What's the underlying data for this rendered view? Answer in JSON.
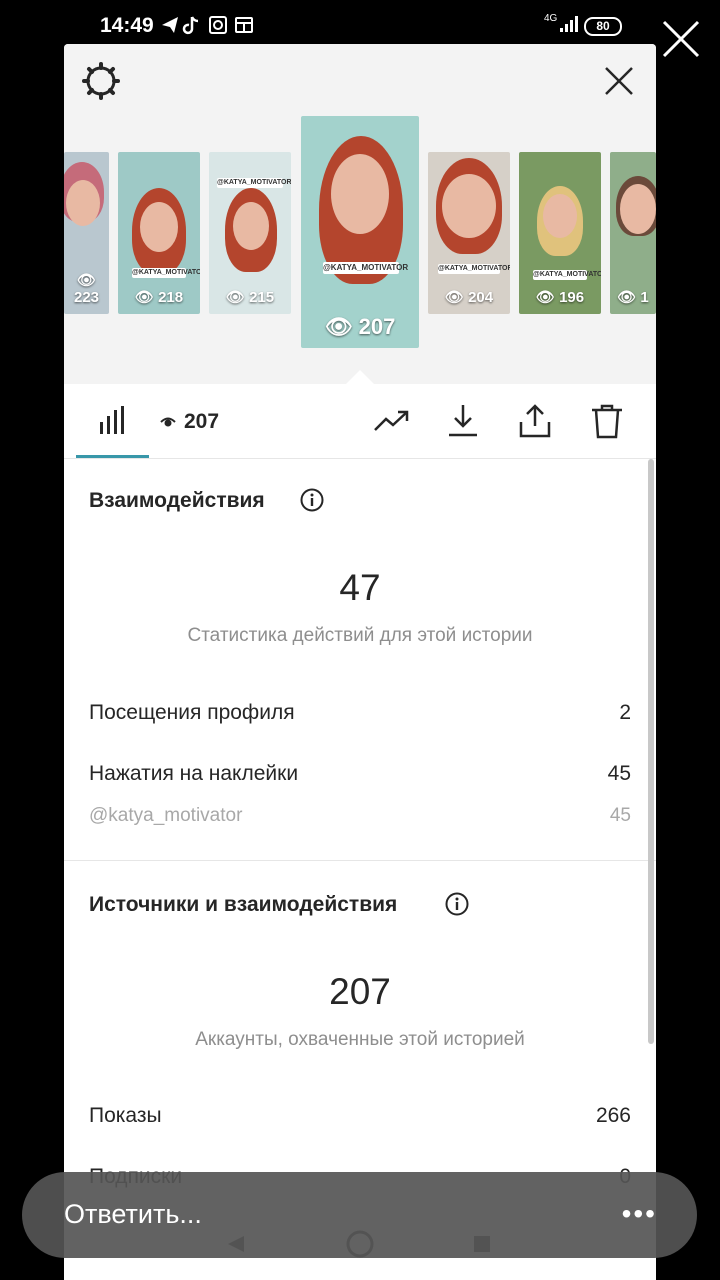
{
  "status_bar": {
    "time": "14:49",
    "network": "4G",
    "battery": "80"
  },
  "thumbnails": [
    {
      "views": "223",
      "tag": ""
    },
    {
      "views": "218",
      "tag": "@KATYA_MOTIVATOR"
    },
    {
      "views": "215",
      "tag": "@KATYA_MOTIVATOR"
    },
    {
      "views": "207",
      "tag": "@KATYA_MOTIVATOR"
    },
    {
      "views": "204",
      "tag": "@KATYA_MOTIVATOR"
    },
    {
      "views": "196",
      "tag": "@KATYA_MOTIVATOR"
    },
    {
      "views": "1",
      "tag": ""
    }
  ],
  "toolbar": {
    "views_count": "207"
  },
  "interactions": {
    "title": "Взаимодействия",
    "total": "47",
    "subtitle": "Статистика действий для этой истории",
    "rows": [
      {
        "label": "Посещения профиля",
        "value": "2"
      },
      {
        "label": "Нажатия на наклейки",
        "value": "45"
      },
      {
        "label": "@katya_motivator",
        "value": "45"
      }
    ]
  },
  "discovery": {
    "title": "Источники и взаимодействия",
    "total": "207",
    "subtitle": "Аккаунты, охваченные этой историей",
    "rows": [
      {
        "label": "Показы",
        "value": "266"
      },
      {
        "label": "Подписки",
        "value": "0"
      }
    ]
  },
  "reply": {
    "placeholder": "Ответить...",
    "more": "•••"
  },
  "colors": {
    "accent": "#3897a9",
    "sheet_bg": "#ffffff",
    "preview_bg": "#f3f3f3"
  }
}
